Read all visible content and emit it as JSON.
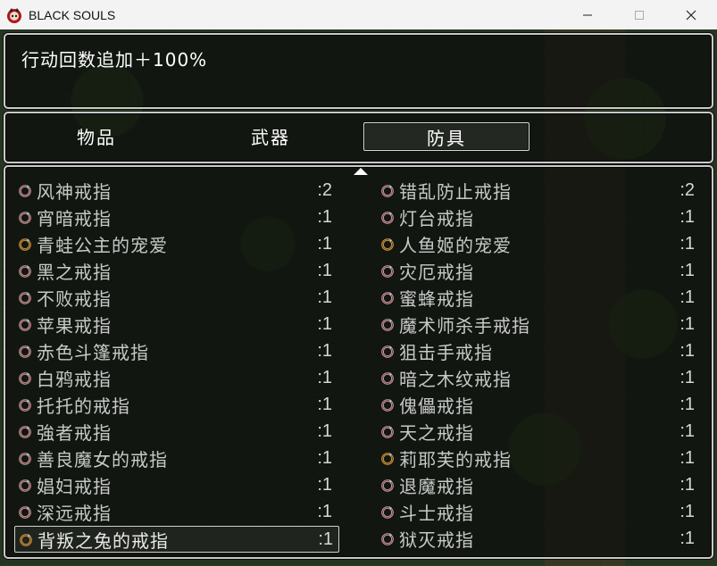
{
  "window": {
    "title": "BLACK SOULS",
    "icon": "app-logo-icon"
  },
  "help": {
    "text": "行动回数追加＋100%"
  },
  "categories": [
    {
      "label": "物品",
      "selected": false
    },
    {
      "label": "武器",
      "selected": false
    },
    {
      "label": "防具",
      "selected": true
    }
  ],
  "colors": {
    "ring_normal": "#d8a0a8",
    "ring_gold": "#e0a030",
    "window_border": "#c9c9c9",
    "text_dim": "#c8c8c8"
  },
  "items": [
    {
      "name": "风神戒指",
      "count": ":2",
      "icon": "ring-icon",
      "gold": false
    },
    {
      "name": "错乱防止戒指",
      "count": ":2",
      "icon": "ring-icon",
      "gold": false
    },
    {
      "name": "宵暗戒指",
      "count": ":1",
      "icon": "ring-icon",
      "gold": false
    },
    {
      "name": "灯台戒指",
      "count": ":1",
      "icon": "ring-icon",
      "gold": false
    },
    {
      "name": "青蛙公主的宠爱",
      "count": ":1",
      "icon": "gold-ring-icon",
      "gold": true
    },
    {
      "name": "人鱼姬的宠爱",
      "count": ":1",
      "icon": "gold-ring-icon",
      "gold": true
    },
    {
      "name": "黑之戒指",
      "count": ":1",
      "icon": "ring-icon",
      "gold": false
    },
    {
      "name": "灾厄戒指",
      "count": ":1",
      "icon": "ring-icon",
      "gold": false
    },
    {
      "name": "不败戒指",
      "count": ":1",
      "icon": "ring-icon",
      "gold": false
    },
    {
      "name": "蜜蜂戒指",
      "count": ":1",
      "icon": "ring-icon",
      "gold": false
    },
    {
      "name": "苹果戒指",
      "count": ":1",
      "icon": "ring-icon",
      "gold": false
    },
    {
      "name": "魔术师杀手戒指",
      "count": ":1",
      "icon": "ring-icon",
      "gold": false
    },
    {
      "name": "赤色斗篷戒指",
      "count": ":1",
      "icon": "ring-icon",
      "gold": false
    },
    {
      "name": "狙击手戒指",
      "count": ":1",
      "icon": "ring-icon",
      "gold": false
    },
    {
      "name": "白鸦戒指",
      "count": ":1",
      "icon": "ring-icon",
      "gold": false
    },
    {
      "name": "暗之木纹戒指",
      "count": ":1",
      "icon": "ring-icon",
      "gold": false
    },
    {
      "name": "托托的戒指",
      "count": ":1",
      "icon": "ring-icon",
      "gold": false
    },
    {
      "name": "傀儡戒指",
      "count": ":1",
      "icon": "ring-icon",
      "gold": false
    },
    {
      "name": "強者戒指",
      "count": ":1",
      "icon": "ring-icon",
      "gold": false
    },
    {
      "name": "天之戒指",
      "count": ":1",
      "icon": "ring-icon",
      "gold": false
    },
    {
      "name": "善良魔女的戒指",
      "count": ":1",
      "icon": "ring-icon",
      "gold": false
    },
    {
      "name": "莉耶芙的戒指",
      "count": ":1",
      "icon": "gold-ring-icon",
      "gold": true
    },
    {
      "name": "娼妇戒指",
      "count": ":1",
      "icon": "ring-icon",
      "gold": false
    },
    {
      "name": "退魔戒指",
      "count": ":1",
      "icon": "ring-icon",
      "gold": false
    },
    {
      "name": "深远戒指",
      "count": ":1",
      "icon": "ring-icon",
      "gold": false
    },
    {
      "name": "斗士戒指",
      "count": ":1",
      "icon": "ring-icon",
      "gold": false
    },
    {
      "name": "背叛之兔的戒指",
      "count": ":1",
      "icon": "gold-ring-icon",
      "gold": true,
      "selected": true
    },
    {
      "name": "狱灭戒指",
      "count": ":1",
      "icon": "ring-icon",
      "gold": false
    }
  ]
}
